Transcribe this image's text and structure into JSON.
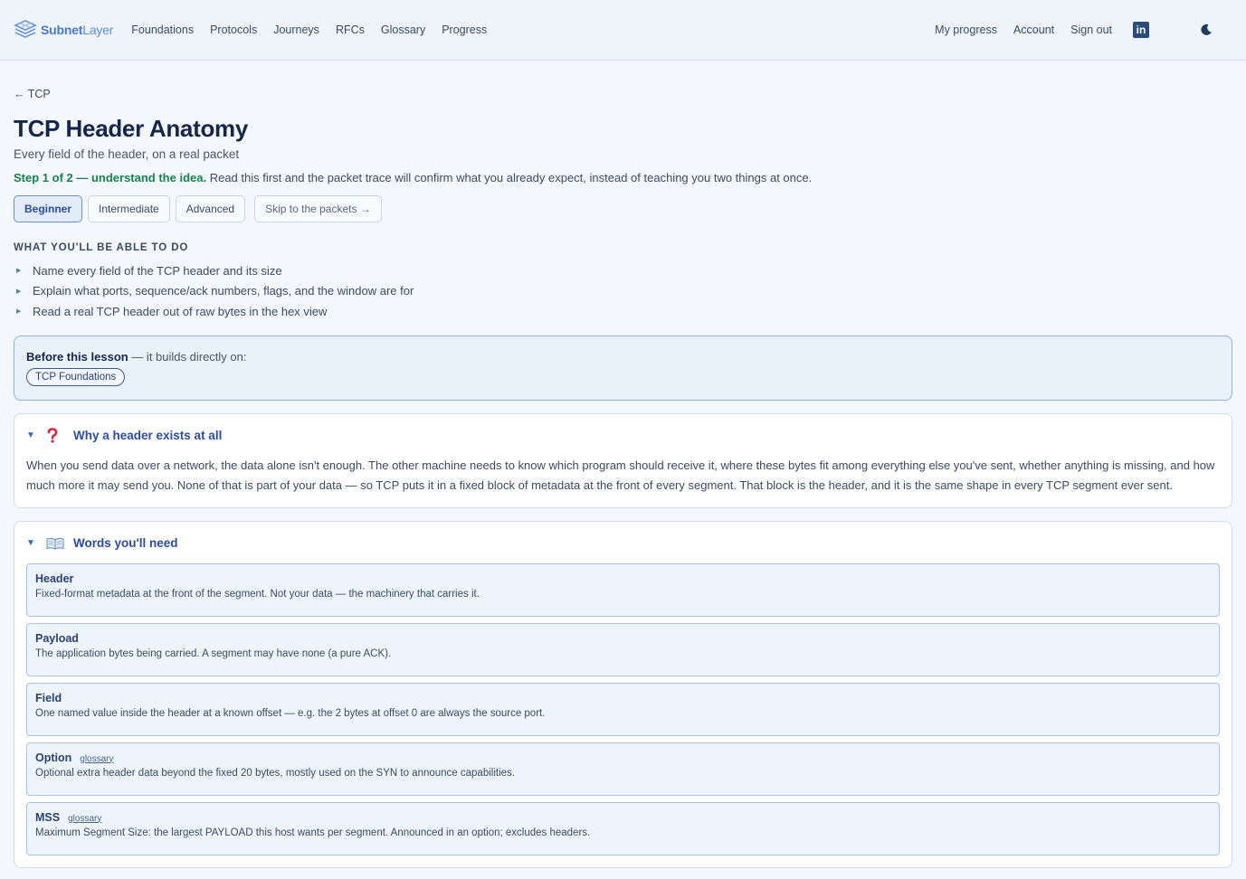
{
  "brand": {
    "name_bold": "Subnet",
    "name_light": "Layer"
  },
  "nav": {
    "links": [
      "Foundations",
      "Protocols",
      "Journeys",
      "RFCs",
      "Glossary",
      "Progress"
    ],
    "right": [
      "My progress",
      "Account",
      "Sign out"
    ],
    "linkedin_glyph": "in"
  },
  "back": {
    "label": "← TCP"
  },
  "page": {
    "title": "TCP Header Anatomy",
    "subtitle": "Every field of the header, on a real packet",
    "step_strong": "Step 1 of 2 — understand the idea.",
    "step_rest": " Read this first and the packet trace will confirm what you already expect, instead of teaching you two things at once."
  },
  "levels": {
    "items": [
      "Beginner",
      "Intermediate",
      "Advanced"
    ],
    "active": "Beginner",
    "skip": "Skip to the packets →"
  },
  "objectives": {
    "heading": "WHAT YOU'LL BE ABLE TO DO",
    "items": [
      "Name every field of the TCP header and its size",
      "Explain what ports, sequence/ack numbers, flags, and the window are for",
      "Read a real TCP header out of raw bytes in the hex view"
    ]
  },
  "prereq": {
    "strong": "Before this lesson",
    "rest": " — it builds directly on:",
    "pill": "TCP Foundations"
  },
  "why": {
    "caret": "▼",
    "icon": "question-mark-icon",
    "title": "Why a header exists at all",
    "body": "When you send data over a network, the data alone isn't enough. The other machine needs to know which program should receive it, where these bytes fit among everything else you've sent, whether anything is missing, and how much more it may send you. None of that is part of your data — so TCP puts it in a fixed block of metadata at the front of every segment. That block is the header, and it is the same shape in every TCP segment ever sent."
  },
  "words": {
    "caret": "▼",
    "icon": "open-book-icon",
    "title": "Words you'll need",
    "terms": [
      {
        "name": "Header",
        "glossary": "",
        "def": "Fixed-format metadata at the front of the segment. Not your data — the machinery that carries it."
      },
      {
        "name": "Payload",
        "glossary": "",
        "def": "The application bytes being carried. A segment may have none (a pure ACK)."
      },
      {
        "name": "Field",
        "glossary": "",
        "def": "One named value inside the header at a known offset — e.g. the 2 bytes at offset 0 are always the source port."
      },
      {
        "name": "Option",
        "glossary": "glossary",
        "def": "Optional extra header data beyond the fixed 20 bytes, mostly used on the SYN to announce capabilities."
      },
      {
        "name": "MSS",
        "glossary": "glossary",
        "def": "Maximum Segment Size: the largest PAYLOAD this host wants per segment. Announced in an option; excludes headers."
      }
    ]
  },
  "colors": {
    "accent": "#2c4aa0",
    "step_green": "#17804f",
    "prereq_border": "#8fb2de"
  }
}
